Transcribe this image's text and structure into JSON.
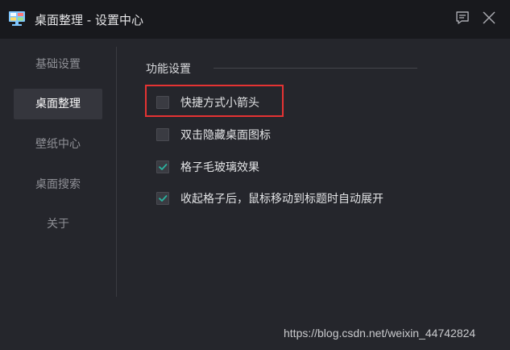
{
  "window": {
    "title": "桌面整理 - 设置中心",
    "app_icon": "monitor-icon",
    "feedback_icon": "feedback-icon",
    "close_icon": "close-icon"
  },
  "sidebar": {
    "items": [
      {
        "label": "基础设置",
        "active": false
      },
      {
        "label": "桌面整理",
        "active": true
      },
      {
        "label": "壁纸中心",
        "active": false
      },
      {
        "label": "桌面搜索",
        "active": false
      },
      {
        "label": "关于",
        "active": false
      }
    ]
  },
  "main": {
    "section_title": "功能设置",
    "options": [
      {
        "label": "快捷方式小箭头",
        "checked": false
      },
      {
        "label": "双击隐藏桌面图标",
        "checked": false
      },
      {
        "label": "格子毛玻璃效果",
        "checked": true
      },
      {
        "label": "收起格子后，鼠标移动到标题时自动展开",
        "checked": true
      }
    ]
  },
  "colors": {
    "accent_check": "#2bb3a0",
    "highlight_border": "#e53333"
  },
  "watermark": "https://blog.csdn.net/weixin_44742824"
}
